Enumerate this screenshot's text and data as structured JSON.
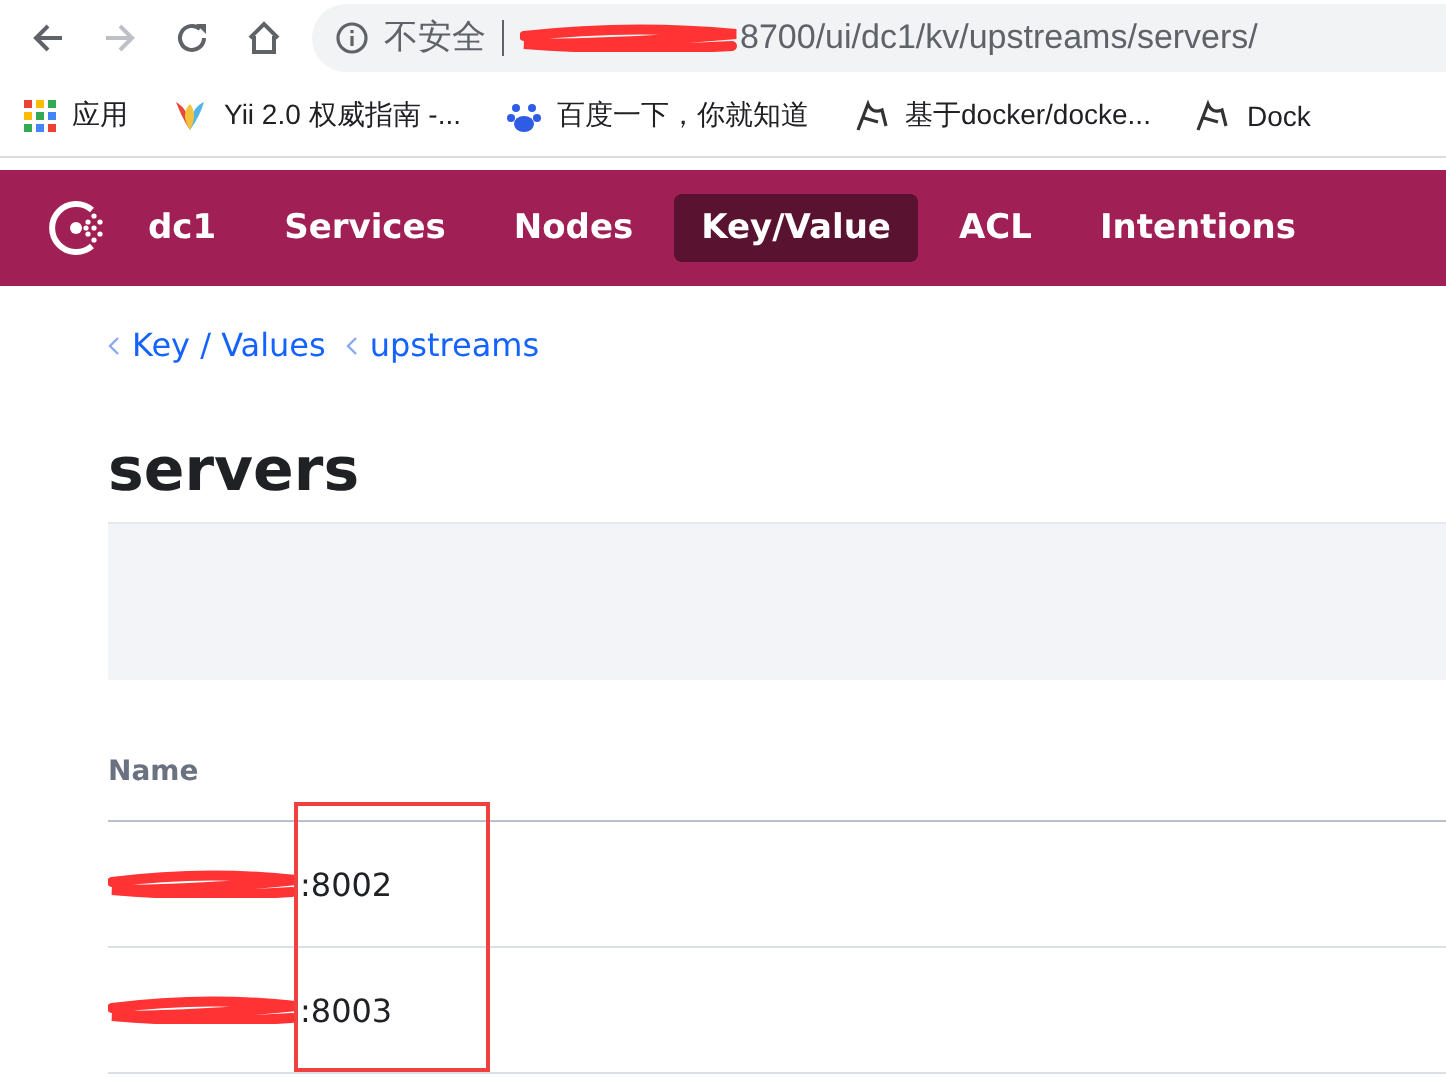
{
  "browser": {
    "security_label": "不安全",
    "url": "8700/ui/dc1/kv/upstreams/servers/"
  },
  "bookmarks": [
    {
      "kind": "apps",
      "label": "应用"
    },
    {
      "kind": "yii",
      "label": "Yii 2.0 权威指南 -..."
    },
    {
      "kind": "baidu",
      "label": "百度一下，你就知道"
    },
    {
      "kind": "page",
      "label": "基于docker/docke..."
    },
    {
      "kind": "page",
      "label": "Dock"
    }
  ],
  "nav": {
    "datacenter": "dc1",
    "items": [
      {
        "label": "Services",
        "selected": false
      },
      {
        "label": "Nodes",
        "selected": false
      },
      {
        "label": "Key/Value",
        "selected": true
      },
      {
        "label": "ACL",
        "selected": false
      },
      {
        "label": "Intentions",
        "selected": false
      }
    ]
  },
  "breadcrumbs": [
    "Key / Values",
    "upstreams"
  ],
  "title": "servers",
  "table": {
    "columns": [
      "Name"
    ],
    "rows": [
      {
        "name": ":8002"
      },
      {
        "name": ":8003"
      }
    ]
  }
}
